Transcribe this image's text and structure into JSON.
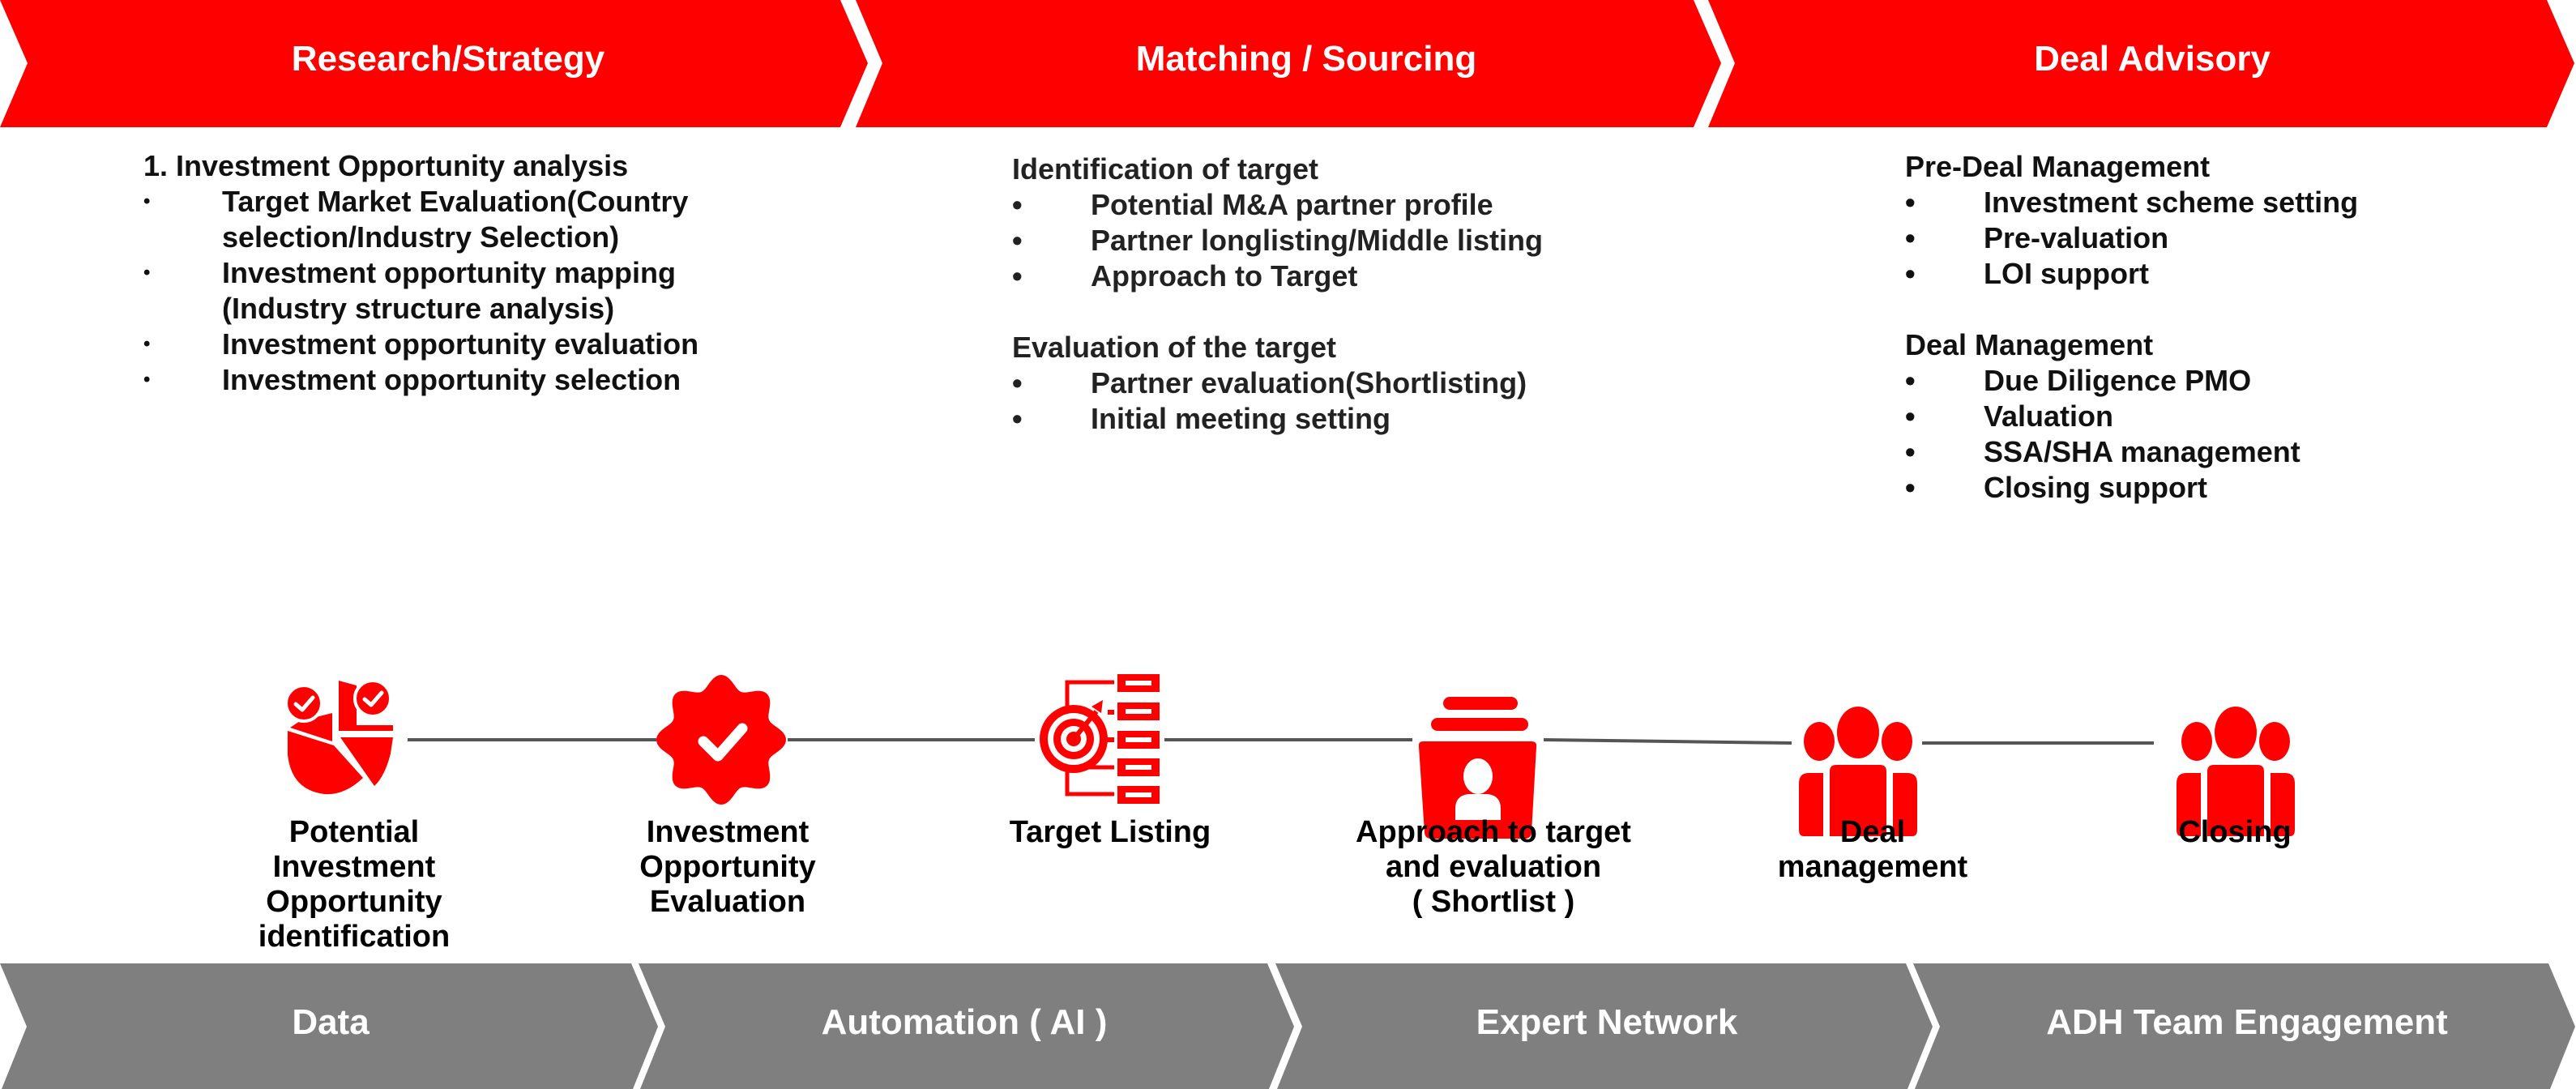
{
  "colors": {
    "primary_red": "#ff0000",
    "band_gray": "#7f7f7f",
    "line_gray": "#555555",
    "text": "#111111"
  },
  "phases": [
    {
      "label": "Research/Strategy"
    },
    {
      "label": "Matching / Sourcing"
    },
    {
      "label": "Deal Advisory"
    }
  ],
  "research": {
    "heading": "1. Investment Opportunity analysis",
    "bullet_glyph": "•",
    "items": [
      {
        "lines": [
          "Target Market Evaluation(Country",
          "selection/Industry Selection)"
        ]
      },
      {
        "lines": [
          "Investment opportunity mapping",
          "(Industry structure analysis)"
        ]
      },
      {
        "lines": [
          "Investment opportunity evaluation"
        ]
      },
      {
        "lines": [
          "Investment opportunity selection"
        ]
      }
    ]
  },
  "matching": {
    "bullet_glyph": "•",
    "groups": [
      {
        "heading": "Identification of target",
        "items": [
          "Potential M&A partner profile",
          "Partner longlisting/Middle listing",
          "Approach to Target"
        ]
      },
      {
        "heading": "Evaluation of the target",
        "items": [
          "Partner evaluation(Shortlisting)",
          "Initial meeting setting"
        ]
      }
    ]
  },
  "advisory": {
    "bullet_glyph": "•",
    "groups": [
      {
        "heading": "Pre-Deal Management",
        "items": [
          "Investment scheme setting",
          "Pre-valuation",
          "LOI support"
        ]
      },
      {
        "heading": "Deal Management",
        "items": [
          "Due Diligence PMO",
          "Valuation",
          "SSA/SHA management",
          "Closing support"
        ]
      }
    ]
  },
  "steps": [
    {
      "icon": "pie-chart-check-icon",
      "lines": [
        "Potential",
        "Investment",
        "Opportunity",
        "identification"
      ]
    },
    {
      "icon": "verified-badge-icon",
      "lines": [
        "Investment",
        "Opportunity",
        "Evaluation"
      ]
    },
    {
      "icon": "target-list-icon",
      "lines": [
        "Target Listing"
      ]
    },
    {
      "icon": "contact-folder-icon",
      "lines": [
        "Approach to target",
        "and evaluation",
        "( Shortlist )"
      ]
    },
    {
      "icon": "team-icon",
      "lines": [
        "Deal",
        "management"
      ]
    },
    {
      "icon": "team-icon",
      "lines": [
        "Closing"
      ]
    }
  ],
  "enablers": [
    {
      "label": "Data"
    },
    {
      "label": "Automation ( AI )"
    },
    {
      "label": "Expert Network"
    },
    {
      "label": "ADH Team Engagement"
    }
  ]
}
